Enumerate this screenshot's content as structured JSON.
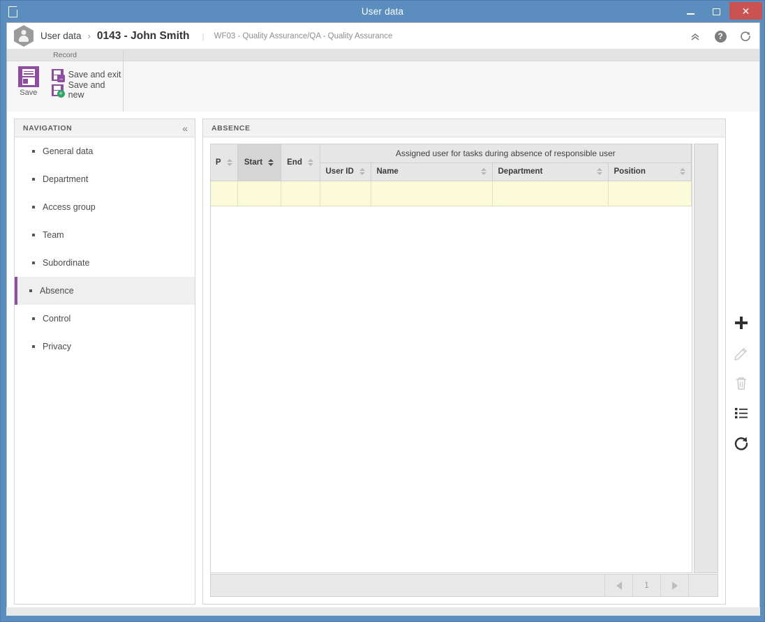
{
  "window": {
    "title": "User data",
    "doc_icon": "document-icon",
    "minimize_label": "Minimize",
    "maximize_label": "Maximize",
    "close_label": "Close",
    "titlebar_color": "#5b8dbe",
    "close_button_color": "#cb5252"
  },
  "header": {
    "avatar_icon": "user-hexagon-icon",
    "breadcrumb_root": "User data",
    "breadcrumb_separator": "›",
    "record_title": "0143 - John Smith",
    "divider": "|",
    "subtitle": "WF03 - Quality Assurance/QA - Quality Assurance",
    "icons": [
      {
        "name": "collapse-ribbon-icon",
        "glyph": "«"
      },
      {
        "name": "help-icon",
        "glyph": "?"
      },
      {
        "name": "refresh-icon",
        "glyph": "↻"
      }
    ]
  },
  "ribbon": {
    "group_title": "Record",
    "save_label": "Save",
    "save_and_exit_label": "Save and exit",
    "save_and_new_label": "Save and new",
    "accent_color": "#8e4d9e",
    "new_badge_color": "#2fa567"
  },
  "navigation": {
    "title": "NAVIGATION",
    "collapse_glyph": "«",
    "active_item": "Absence",
    "accent_color": "#8e4d9e",
    "items": [
      {
        "label": "General data"
      },
      {
        "label": "Department"
      },
      {
        "label": "Access group"
      },
      {
        "label": "Team"
      },
      {
        "label": "Subordinate"
      },
      {
        "label": "Absence"
      },
      {
        "label": "Control"
      },
      {
        "label": "Privacy"
      }
    ]
  },
  "panel": {
    "title": "ABSENCE",
    "grid": {
      "group_header": "Assigned user for tasks during absence of responsible user",
      "columns": [
        {
          "label": "P",
          "sorted": false,
          "sort_dir": "none"
        },
        {
          "label": "Start",
          "sorted": true,
          "sort_dir": "asc"
        },
        {
          "label": "End",
          "sorted": false,
          "sort_dir": "none"
        },
        {
          "label": "User ID",
          "sorted": false,
          "sort_dir": "none"
        },
        {
          "label": "Name",
          "sorted": false,
          "sort_dir": "none"
        },
        {
          "label": "Department",
          "sorted": false,
          "sort_dir": "none"
        },
        {
          "label": "Position",
          "sorted": false,
          "sort_dir": "none"
        }
      ],
      "rows": [
        {
          "P": "",
          "Start": "",
          "End": "",
          "User ID": "",
          "Name": "",
          "Department": "",
          "Position": ""
        }
      ],
      "empty_row_color": "#fbfbd9"
    },
    "pager": {
      "prev_label": "Previous page",
      "page_number": "1",
      "next_label": "Next page"
    },
    "actions": [
      {
        "name": "add-row-button",
        "glyph": "plus",
        "enabled": true
      },
      {
        "name": "edit-row-button",
        "glyph": "pencil",
        "enabled": false
      },
      {
        "name": "delete-row-button",
        "glyph": "trash",
        "enabled": false
      },
      {
        "name": "list-view-button",
        "glyph": "list",
        "enabled": true
      },
      {
        "name": "reload-grid-button",
        "glyph": "refresh",
        "enabled": true
      }
    ]
  }
}
